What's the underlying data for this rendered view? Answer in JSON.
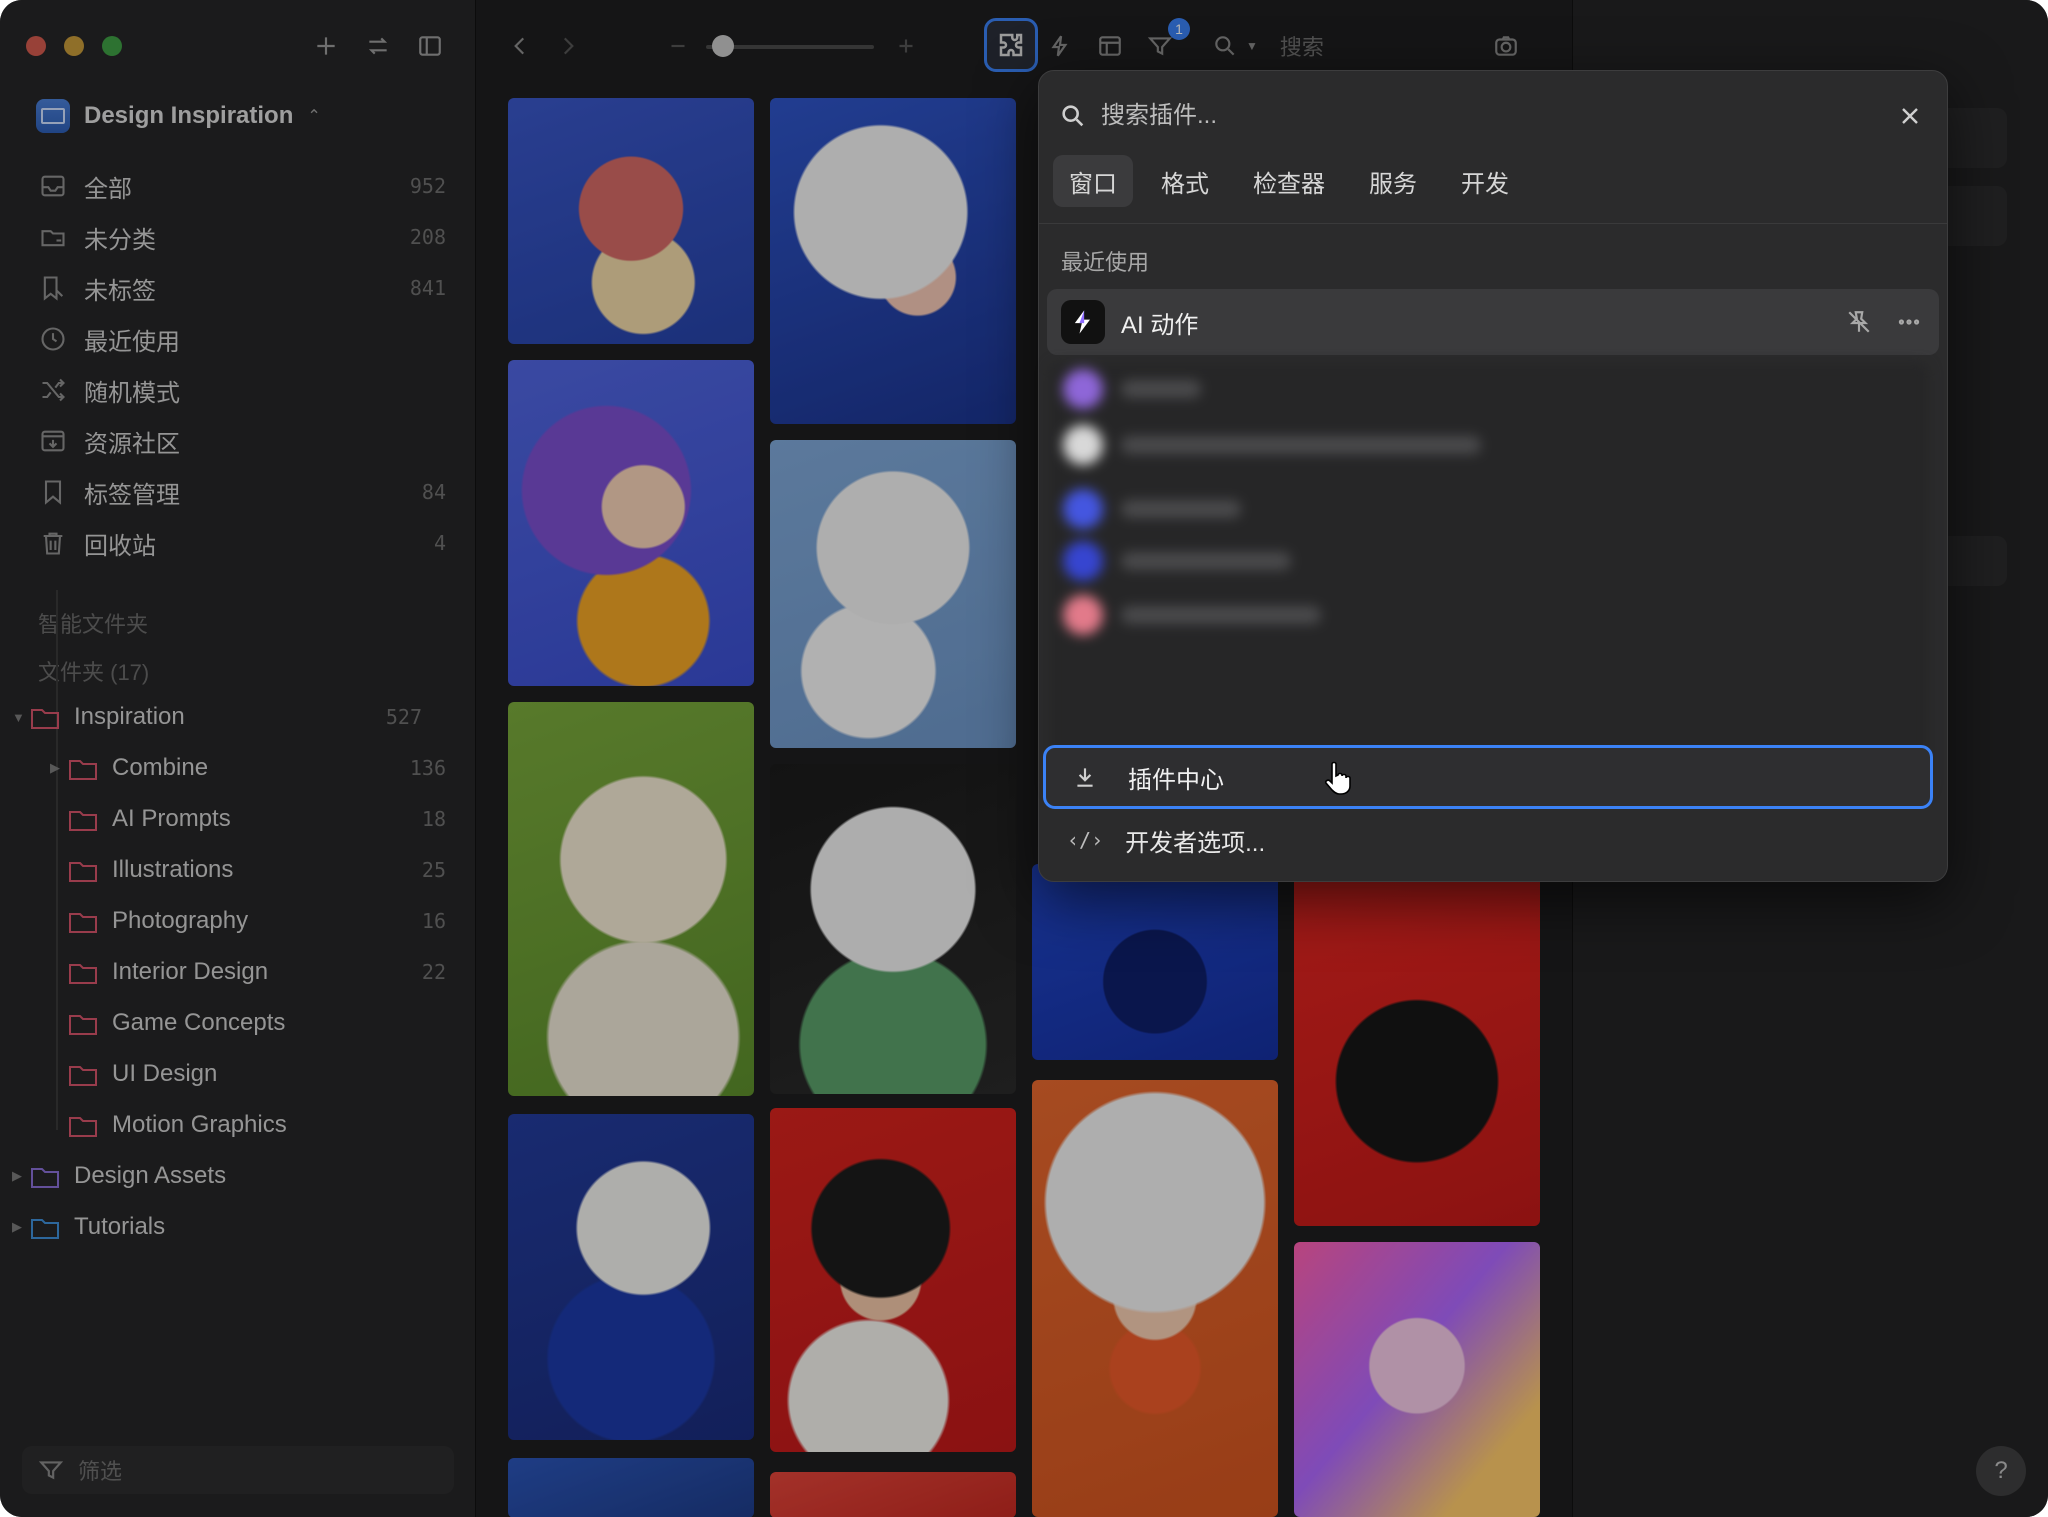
{
  "sidebar": {
    "library": {
      "name": "Design Inspiration",
      "chevron": "⌃"
    },
    "nav": [
      {
        "label": "全部",
        "count": "952",
        "icon": "inbox-icon"
      },
      {
        "label": "未分类",
        "count": "208",
        "icon": "unfiled-folder-icon"
      },
      {
        "label": "未标签",
        "count": "841",
        "icon": "untagged-icon"
      },
      {
        "label": "最近使用",
        "count": "",
        "icon": "clock-icon"
      },
      {
        "label": "随机模式",
        "count": "",
        "icon": "shuffle-icon"
      },
      {
        "label": "资源社区",
        "count": "",
        "icon": "download-box-icon"
      },
      {
        "label": "标签管理",
        "count": "84",
        "icon": "bookmark-icon"
      },
      {
        "label": "回收站",
        "count": "4",
        "icon": "trash-icon"
      }
    ],
    "smart_folders_label": "智能文件夹",
    "folders_label": "文件夹 (17)",
    "folders": [
      {
        "label": "Inspiration",
        "count": "527",
        "color": "#d4546a",
        "expanded": true
      },
      {
        "label": "Combine",
        "count": "136",
        "color": "#d4546a"
      },
      {
        "label": "AI Prompts",
        "count": "18",
        "color": "#d4546a"
      },
      {
        "label": "Illustrations",
        "count": "25",
        "color": "#d4546a"
      },
      {
        "label": "Photography",
        "count": "16",
        "color": "#d4546a"
      },
      {
        "label": "Interior Design",
        "count": "22",
        "color": "#d4546a"
      },
      {
        "label": "Game Concepts",
        "count": "",
        "color": "#d4546a"
      },
      {
        "label": "UI Design",
        "count": "",
        "color": "#d4546a"
      },
      {
        "label": "Motion Graphics",
        "count": "",
        "color": "#d4546a"
      },
      {
        "label": "Design Assets",
        "count": "",
        "color": "#8a6fd6"
      },
      {
        "label": "Tutorials",
        "count": "",
        "color": "#3f8fd8"
      }
    ],
    "filter_placeholder": "筛选"
  },
  "toolbar": {
    "search_placeholder": "搜索",
    "filter_badge": "1",
    "zoom_level": 0.1
  },
  "popover": {
    "search_placeholder": "搜索插件...",
    "tabs": [
      "窗口",
      "格式",
      "检查器",
      "服务",
      "开发"
    ],
    "active_tab": "窗口",
    "recent_label": "最近使用",
    "recent_item": "AI 动作",
    "plugin_center": "插件中心",
    "developer_options": "开发者选项...",
    "code_glyph": "‹/›"
  },
  "help_label": "?",
  "colors": {
    "accent": "#3b82f6",
    "background": "#1e1e1f"
  }
}
